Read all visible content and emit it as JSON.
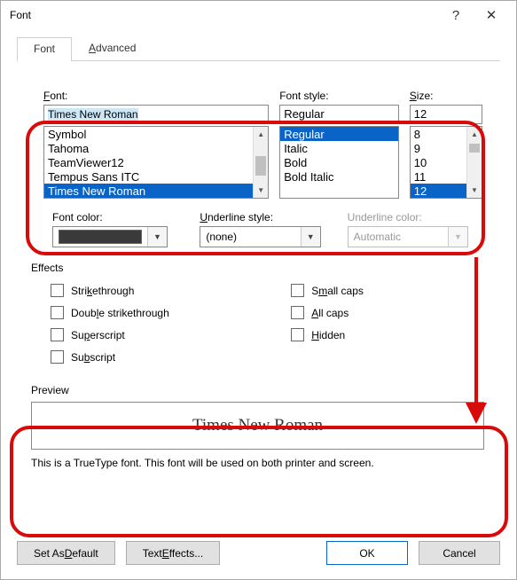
{
  "title": "Font",
  "titlebar": {
    "help_label": "?",
    "close_label": "✕"
  },
  "tabs": {
    "font": "Font",
    "advanced": "Advanced"
  },
  "labels": {
    "font": "Font:",
    "style": "Font style:",
    "size": "Size:",
    "font_color": "Font color:",
    "underline_style": "Underline style:",
    "underline_color": "Underline color:",
    "effects": "Effects",
    "preview": "Preview"
  },
  "inputs": {
    "font_value": "Times New Roman",
    "style_value": "Regular",
    "size_value": "12"
  },
  "lists": {
    "fonts": [
      "Symbol",
      "Tahoma",
      "TeamViewer12",
      "Tempus Sans ITC",
      "Times New Roman"
    ],
    "font_selected": "Times New Roman",
    "styles": [
      "Regular",
      "Italic",
      "Bold",
      "Bold Italic"
    ],
    "style_selected": "Regular",
    "sizes": [
      "8",
      "9",
      "10",
      "11",
      "12"
    ],
    "size_selected": "12"
  },
  "dropdowns": {
    "font_color_hex": "#3a3a3a",
    "underline_style": "(none)",
    "underline_color": "Automatic"
  },
  "effects": {
    "strikethrough": "Strikethrough",
    "dstrikethrough": "Double strikethrough",
    "superscript": "Superscript",
    "subscript": "Subscript",
    "smallcaps": "Small caps",
    "allcaps": "All caps",
    "hidden": "Hidden"
  },
  "preview": {
    "sample": "Times New Roman",
    "desc": "This is a TrueType font. This font will be used on both printer and screen."
  },
  "buttons": {
    "set_default": "Set As Default",
    "text_effects": "Text Effects...",
    "ok": "OK",
    "cancel": "Cancel"
  },
  "a11y": {
    "underline_a": "A",
    "dvanced": "dvanced"
  }
}
